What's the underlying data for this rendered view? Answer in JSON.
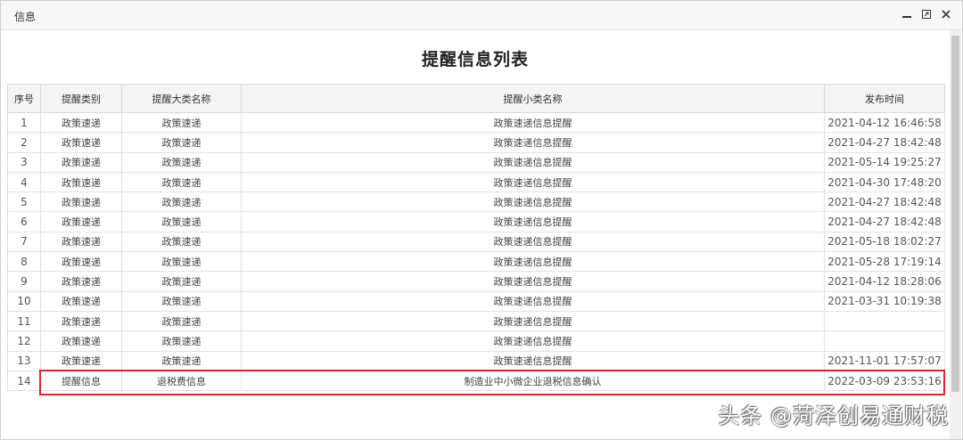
{
  "window": {
    "title": "信息"
  },
  "page": {
    "title": "提醒信息列表"
  },
  "table": {
    "headers": {
      "index": "序号",
      "category": "提醒类别",
      "major": "提醒大类名称",
      "minor": "提醒小类名称",
      "time": "发布时间"
    },
    "rows": [
      {
        "index": "1",
        "category": "政策速递",
        "major": "政策速递",
        "minor": "政策速递信息提醒",
        "time": "2021-04-12 16:46:58"
      },
      {
        "index": "2",
        "category": "政策速递",
        "major": "政策速递",
        "minor": "政策速递信息提醒",
        "time": "2021-04-27 18:42:48"
      },
      {
        "index": "3",
        "category": "政策速递",
        "major": "政策速递",
        "minor": "政策速递信息提醒",
        "time": "2021-05-14 19:25:27"
      },
      {
        "index": "4",
        "category": "政策速递",
        "major": "政策速递",
        "minor": "政策速递信息提醒",
        "time": "2021-04-30 17:48:20"
      },
      {
        "index": "5",
        "category": "政策速递",
        "major": "政策速递",
        "minor": "政策速递信息提醒",
        "time": "2021-04-27 18:42:48"
      },
      {
        "index": "6",
        "category": "政策速递",
        "major": "政策速递",
        "minor": "政策速递信息提醒",
        "time": "2021-04-27 18:42:48"
      },
      {
        "index": "7",
        "category": "政策速递",
        "major": "政策速递",
        "minor": "政策速递信息提醒",
        "time": "2021-05-18 18:02:27"
      },
      {
        "index": "8",
        "category": "政策速递",
        "major": "政策速递",
        "minor": "政策速递信息提醒",
        "time": "2021-05-28 17:19:14"
      },
      {
        "index": "9",
        "category": "政策速递",
        "major": "政策速递",
        "minor": "政策速递信息提醒",
        "time": "2021-04-12 18:28:06"
      },
      {
        "index": "10",
        "category": "政策速递",
        "major": "政策速递",
        "minor": "政策速递信息提醒",
        "time": "2021-03-31 10:19:38"
      },
      {
        "index": "11",
        "category": "政策速递",
        "major": "政策速递",
        "minor": "政策速递信息提醒",
        "time": ""
      },
      {
        "index": "12",
        "category": "政策速递",
        "major": "政策速递",
        "minor": "政策速递信息提醒",
        "time": ""
      },
      {
        "index": "13",
        "category": "政策速递",
        "major": "政策速递",
        "minor": "政策速递信息提醒",
        "time": "2021-11-01 17:57:07"
      },
      {
        "index": "14",
        "category": "提醒信息",
        "major": "退税费信息",
        "minor": "制造业中小微企业退税信息确认",
        "time": "2022-03-09 23:53:16"
      }
    ]
  },
  "watermark": {
    "text": "头条 @菏泽创易通财税"
  },
  "colors": {
    "highlight_border": "#e2232a",
    "header_bg": "#f4f4f4",
    "titlebar_bg": "#f7f7f7"
  },
  "icons": {
    "minimize": "minimize-icon",
    "maximize": "maximize-icon",
    "close": "close-icon"
  }
}
